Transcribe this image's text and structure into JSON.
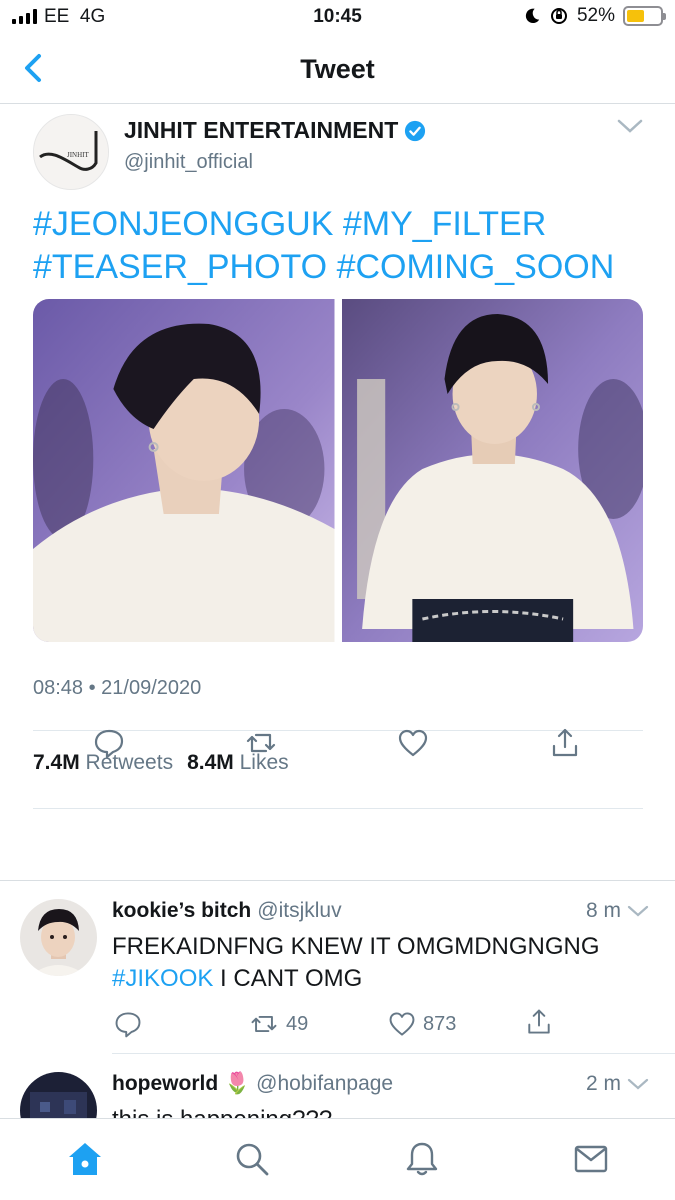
{
  "status_bar": {
    "carrier": "EE",
    "network": "4G",
    "time": "10:45",
    "battery_percent": "52%",
    "battery_level": 0.52
  },
  "nav": {
    "title": "Tweet",
    "back_icon": "chevron-left-icon"
  },
  "tweet": {
    "author_name": "JINHIT ENTERTAINMENT",
    "author_handle": "@jinhit_official",
    "text_line1": "#JEONJEONGGUK #MY_FILTER",
    "text_line2": "#TEASER_PHOTO #COMING_SOON",
    "timestamp": "08:48 • 21/09/2020",
    "retweets_count": "7.4M",
    "retweets_label": "Retweets",
    "likes_count": "8.4M",
    "likes_label": "Likes"
  },
  "replies": [
    {
      "name": "kookie’s bitch",
      "handle": "@itsjkluv",
      "time": "8 m",
      "text_line1": "FREKAIDNFNG KNEW IT OMGMDNGNGNG",
      "text_tag": "#JIKOOK",
      "text_rest": " I CANT OMG",
      "retweets": "49",
      "likes": "873"
    },
    {
      "name": "hopeworld",
      "emoji": "🌷",
      "handle": "@hobifanpage",
      "time": "2 m",
      "text_line1": "this is happening???"
    }
  ],
  "colors": {
    "accent": "#1da1f2",
    "secondary_text": "#657786",
    "divider": "#e1e8ed"
  }
}
